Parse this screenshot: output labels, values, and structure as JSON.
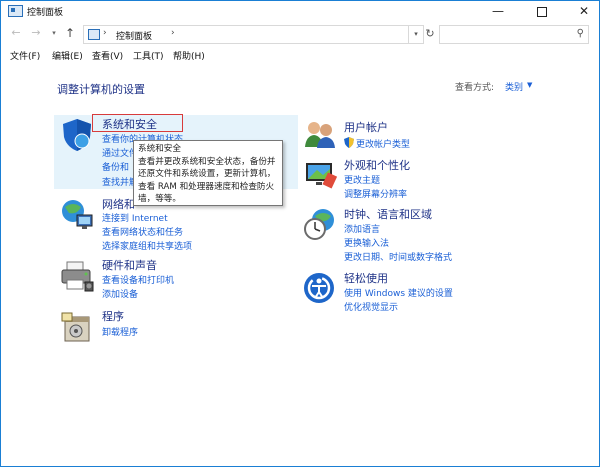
{
  "window": {
    "title": "控制面板"
  },
  "address": {
    "path": "控制面板",
    "separator": "›"
  },
  "menu": [
    "文件(F)",
    "编辑(E)",
    "查看(V)",
    "工具(T)",
    "帮助(H)"
  ],
  "content": {
    "heading": "调整计算机的设置",
    "view_by_label": "查看方式:",
    "view_by_value": "类别"
  },
  "categories": {
    "system": {
      "title": "系统和安全",
      "links": [
        "查看你的计算机状态",
        "通过文件",
        "备份和",
        "查找并解"
      ]
    },
    "network": {
      "title": "网络和",
      "links": [
        "连接到 Internet",
        "查看网络状态和任务",
        "选择家庭组和共享选项"
      ]
    },
    "hardware": {
      "title": "硬件和声音",
      "links": [
        "查看设备和打印机",
        "添加设备"
      ]
    },
    "programs": {
      "title": "程序",
      "links": [
        "卸载程序"
      ]
    },
    "user": {
      "title": "用户帐户",
      "links": [
        "更改帐户类型"
      ]
    },
    "appearance": {
      "title": "外观和个性化",
      "links": [
        "更改主题",
        "调整屏幕分辨率"
      ]
    },
    "clock": {
      "title": "时钟、语言和区域",
      "links": [
        "添加语言",
        "更换输入法",
        "更改日期、时间或数字格式"
      ]
    },
    "ease": {
      "title": "轻松使用",
      "links": [
        "使用 Windows 建议的设置",
        "优化视觉显示"
      ]
    }
  },
  "tooltip": {
    "lines": [
      "系统和安全",
      "查看并更改系统和安全状态，备份并",
      "还原文件和系统设置，更新计算机，",
      "查看 RAM 和处理器速度和检查防火",
      "墙，等等。"
    ]
  },
  "colors": {
    "link": "#1a5fd6",
    "heading": "#1e3287",
    "hover": "#e5f3fb",
    "focus": "#d83b3b",
    "frame": "#1a7fd4"
  },
  "icons": [
    "control-panel-icon",
    "shield-icon",
    "network-icon",
    "printer-icon",
    "programs-icon",
    "users-icon",
    "appearance-icon",
    "clock-globe-icon",
    "ease-of-access-icon",
    "uac-shield-icon"
  ]
}
